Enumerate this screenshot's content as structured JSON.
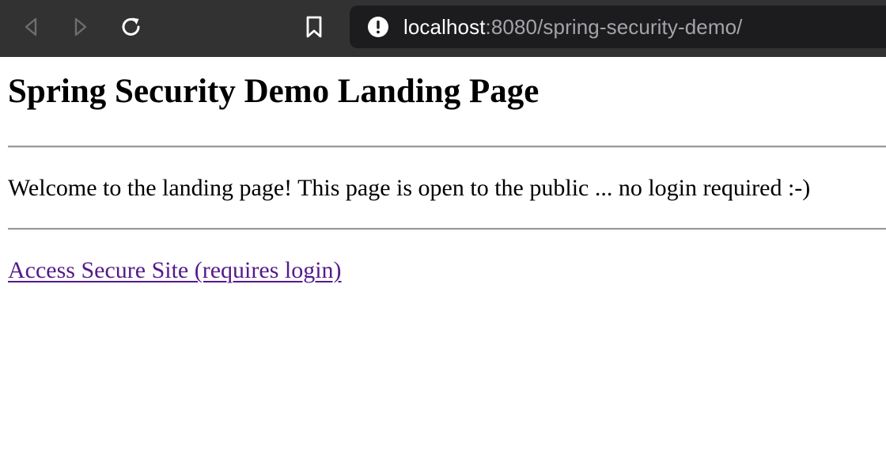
{
  "browser": {
    "url_host": "localhost",
    "url_rest": ":8080/spring-security-demo/",
    "icons": {
      "back": "back-arrow-icon",
      "forward": "forward-arrow-icon",
      "reload": "reload-icon",
      "bookmark": "bookmark-icon",
      "site_info": "info-icon"
    },
    "colors": {
      "toolbar": "#323233",
      "address_bar": "#1c1b1e",
      "url_host": "#ffffff",
      "url_rest": "#a4a3a8"
    }
  },
  "page": {
    "title": "Spring Security Demo Landing Page",
    "welcome_text": "Welcome to the landing page! This page is open to the public ... no login required :-)",
    "secure_link_label": "Access Secure Site (requires login)",
    "colors": {
      "link_visited": "#551a8b",
      "text": "#000000",
      "background": "#ffffff"
    }
  }
}
